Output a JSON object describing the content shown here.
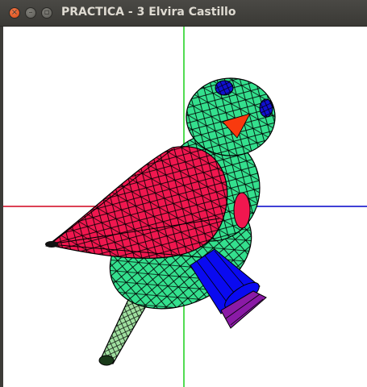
{
  "window": {
    "title": "PRACTICA - 3 Elvira Castillo",
    "controls": {
      "close_icon": "×",
      "minimize_icon": "–",
      "maximize_icon": "▫"
    }
  },
  "scene": {
    "background": "#ffffff",
    "axes": {
      "x_color": "#d0021b",
      "x_neg_color": "#d0021b",
      "x_pos_color": "#0000c8",
      "y_color": "#18d018"
    },
    "colors": {
      "body": "#34e08e",
      "wing": "#f0174f",
      "eye": "#1010d0",
      "beak": "#f83a0e",
      "leg": "#0a0af0",
      "foot": "#8a1aa6",
      "tail": "#a0e0a0",
      "mesh": "#000000"
    }
  }
}
